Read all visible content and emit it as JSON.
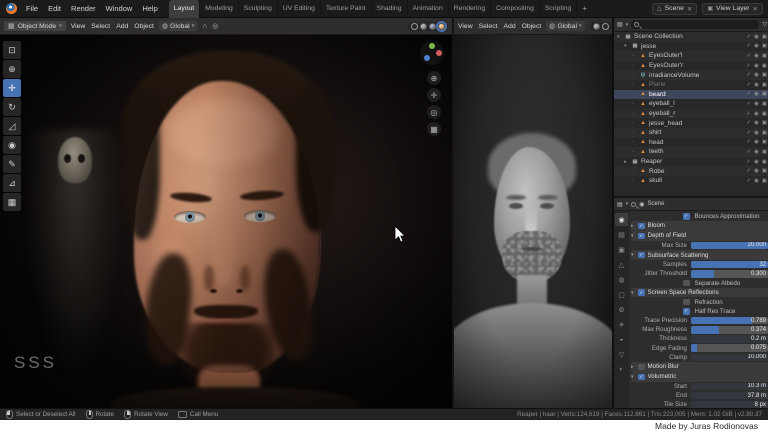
{
  "icons": {
    "chevron": "▾",
    "close": "✕",
    "grid": "▦",
    "globe": "◍",
    "magnet": "∩",
    "proportional": "◎",
    "editor_menu": "▤",
    "funnel": "▽",
    "scene": "△",
    "view_layer": "▣",
    "check": "✓",
    "eye": "◉",
    "camera": "▣",
    "breadcrumb_icon": "◉",
    "zoom": "⊕",
    "pan": "✛",
    "camera_view": "◎",
    "persp": "▦",
    "dot": "·"
  },
  "topbar": {
    "menus": [
      "File",
      "Edit",
      "Render",
      "Window",
      "Help"
    ],
    "workspaces": [
      {
        "label": "Layout",
        "cls": "active"
      },
      {
        "label": "Modeling"
      },
      {
        "label": "Sculpting"
      },
      {
        "label": "UV Editing"
      },
      {
        "label": "Texture Paint"
      },
      {
        "label": "Shading"
      },
      {
        "label": "Animation"
      },
      {
        "label": "Rendering"
      },
      {
        "label": "Compositing"
      },
      {
        "label": "Scripting"
      }
    ],
    "new_workspace_label": "+",
    "scene": {
      "label": "Scene"
    },
    "view_layer": {
      "label": "View Layer"
    }
  },
  "viewport_main": {
    "mode": "Object Mode",
    "menus": [
      "View",
      "Select",
      "Add",
      "Object"
    ],
    "orientation": "Global",
    "overlay_text": "SSS",
    "tools": [
      {
        "name": "select-box",
        "glyph": "⊡"
      },
      {
        "name": "cursor",
        "glyph": "⊕"
      },
      {
        "name": "move",
        "glyph": "✛",
        "cls": "active"
      },
      {
        "name": "rotate",
        "glyph": "↻"
      },
      {
        "name": "scale",
        "glyph": "◿"
      },
      {
        "name": "transform",
        "glyph": "◉"
      },
      {
        "name": "annotate",
        "glyph": "✎"
      },
      {
        "name": "measure",
        "glyph": "⊿"
      },
      {
        "name": "add-cube",
        "glyph": "▦"
      }
    ]
  },
  "viewport_sculpt": {
    "menus": [
      "View",
      "Select",
      "Add",
      "Object"
    ],
    "orientation": "Global"
  },
  "outliner": {
    "rows": [
      {
        "label": "Scene Collection",
        "cls": "collection d0",
        "tri": "▾",
        "icon": "▦"
      },
      {
        "label": "jesse",
        "cls": "collection d1",
        "tri": "▾",
        "icon": "▦"
      },
      {
        "label": "EyesOuter'l",
        "cls": "mesh d2",
        "tri": "·",
        "icon": "▲"
      },
      {
        "label": "EyesOuter'r",
        "cls": "mesh d2",
        "tri": "·",
        "icon": "▲"
      },
      {
        "label": "irradianceVolume",
        "cls": "probe d2",
        "tri": "·",
        "icon": "◍"
      },
      {
        "label": "Plane",
        "cls": "mesh d2 dim",
        "tri": "·",
        "icon": "▲"
      },
      {
        "label": "beard",
        "cls": "mesh d2 selected",
        "tri": "·",
        "icon": "▲"
      },
      {
        "label": "eyeball_l",
        "cls": "mesh d2",
        "tri": "·",
        "icon": "▲"
      },
      {
        "label": "eyeball_r",
        "cls": "mesh d2",
        "tri": "·",
        "icon": "▲"
      },
      {
        "label": "jesse_head",
        "cls": "mesh d2",
        "tri": "·",
        "icon": "▲"
      },
      {
        "label": "shirt",
        "cls": "mesh d2",
        "tri": "·",
        "icon": "▲"
      },
      {
        "label": "head",
        "cls": "mesh d2",
        "tri": "·",
        "icon": "▲"
      },
      {
        "label": "teeth",
        "cls": "mesh d2",
        "tri": "·",
        "icon": "▲"
      },
      {
        "label": "Reaper",
        "cls": "collection d1",
        "tri": "▸",
        "icon": "▦"
      },
      {
        "label": "Robe",
        "cls": "mesh d2",
        "tri": "·",
        "icon": "▲"
      },
      {
        "label": "skull",
        "cls": "mesh d2",
        "tri": "·",
        "icon": "▲"
      }
    ]
  },
  "properties": {
    "breadcrumb": "Scene",
    "tabs": [
      {
        "name": "render-tab",
        "glyph": "◉",
        "cls": "active"
      },
      {
        "name": "output-tab",
        "glyph": "▤"
      },
      {
        "name": "view-layer-tab",
        "glyph": "▣"
      },
      {
        "name": "scene-tab",
        "glyph": "△"
      },
      {
        "name": "world-tab",
        "glyph": "◍"
      },
      {
        "name": "object-tab",
        "glyph": "▢"
      },
      {
        "name": "modifiers-tab",
        "glyph": "⚙"
      },
      {
        "name": "particles-tab",
        "glyph": "✳"
      },
      {
        "name": "physics-tab",
        "glyph": "◒"
      },
      {
        "name": "object-data-tab",
        "glyph": "▽"
      },
      {
        "name": "material-tab",
        "glyph": "◐"
      }
    ],
    "rows": [
      {
        "cls": "check on",
        "label": "Bounces Approximation",
        "chk": "✓"
      },
      {
        "cls": "section",
        "tri": "▸",
        "chk": "✓",
        "label": "Bloom"
      },
      {
        "cls": "section",
        "tri": "▾",
        "chk": "✓",
        "label": "Depth of Field"
      },
      {
        "cls": "slider",
        "label": "Max Size",
        "value": "20.000",
        "fill": 100
      },
      {
        "cls": "section",
        "tri": "▾",
        "chk": "✓",
        "label": "Subsurface Scattering"
      },
      {
        "cls": "slider",
        "label": "Samples",
        "value": "32",
        "fill": 100
      },
      {
        "cls": "slider",
        "label": "Jitter Threshold",
        "value": "0.300",
        "fill": 30
      },
      {
        "cls": "check off",
        "label": "Separate Albedo",
        "chk": ""
      },
      {
        "cls": "section",
        "tri": "▾",
        "chk": "✓",
        "label": "Screen Space Reflections"
      },
      {
        "cls": "check off",
        "label": "Refraction",
        "chk": ""
      },
      {
        "cls": "check on",
        "label": "Half Res Trace",
        "chk": "✓"
      },
      {
        "cls": "slider",
        "label": "Trace Precision",
        "value": "0.789",
        "fill": 79
      },
      {
        "cls": "slider",
        "label": "Max Roughness",
        "value": "0.374",
        "fill": 37
      },
      {
        "cls": "value",
        "label": "Thickness",
        "value": "0.2 m"
      },
      {
        "cls": "slider",
        "label": "Edge Fading",
        "value": "0.075",
        "fill": 8
      },
      {
        "cls": "value",
        "label": "Clamp",
        "value": "10.000"
      },
      {
        "cls": "section off",
        "tri": "▸",
        "chk": "",
        "label": "Motion Blur"
      },
      {
        "cls": "section",
        "tri": "▾",
        "chk": "✓",
        "label": "Volumetric"
      },
      {
        "cls": "value",
        "label": "Start",
        "value": "10.3 m"
      },
      {
        "cls": "value",
        "label": "End",
        "value": "37.8 m"
      },
      {
        "cls": "value",
        "label": "Tile Size",
        "value": "8 px"
      }
    ]
  },
  "statusbar": {
    "hints": [
      {
        "cls": "mouse-left",
        "label": "Select or Deselect All"
      },
      {
        "cls": "mouse-middle",
        "label": "Rotate"
      },
      {
        "cls": "mouse-right",
        "label": "Rotate View"
      },
      {
        "cls": "key",
        "label": "Call Menu"
      }
    ],
    "info": "Reaper | haar | Verts:124,619 | Faces:112,861 | Tris:223,005 | Mem: 1.02 GiB | v2.80.37"
  },
  "credit": "Made by Juras Rodionovas",
  "colors": {
    "accent_blue": "#4772b3",
    "accent_orange": "#e8923a",
    "panel_bg": "#2d2d2d"
  }
}
